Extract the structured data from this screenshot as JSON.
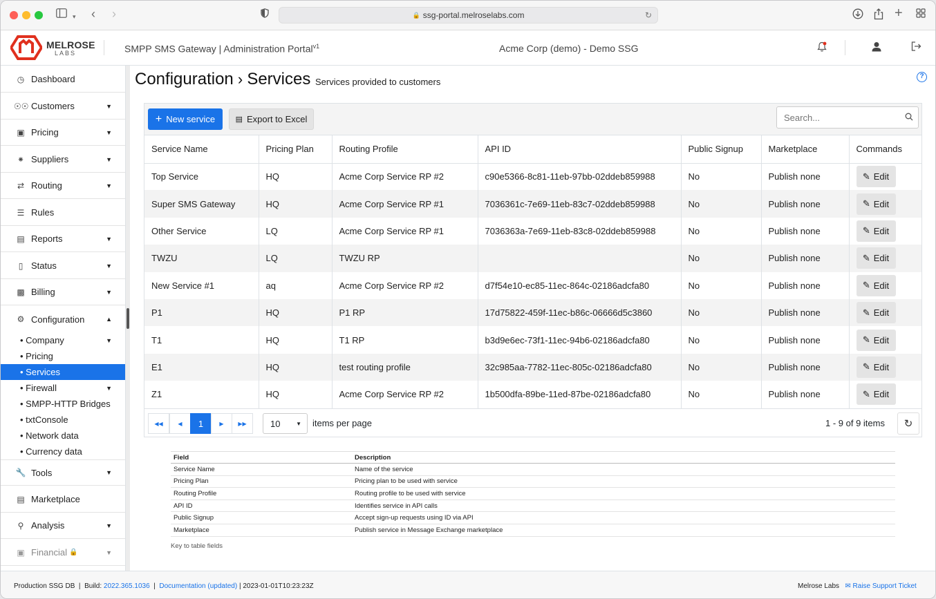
{
  "browser": {
    "url": "ssg-portal.melroselabs.com"
  },
  "logo": {
    "name": "MELROSE",
    "sub": "LABS"
  },
  "header": {
    "app_title": "SMPP SMS Gateway | Administration Portal",
    "app_version": "v1",
    "company": "Acme Corp (demo) - Demo SSG"
  },
  "sidebar": {
    "items": [
      {
        "label": "Dashboard"
      },
      {
        "label": "Customers"
      },
      {
        "label": "Pricing"
      },
      {
        "label": "Suppliers"
      },
      {
        "label": "Routing"
      },
      {
        "label": "Rules"
      },
      {
        "label": "Reports"
      },
      {
        "label": "Status"
      },
      {
        "label": "Billing"
      },
      {
        "label": "Configuration"
      }
    ],
    "config_sub": [
      {
        "label": "Company"
      },
      {
        "label": "Pricing"
      },
      {
        "label": "Services"
      },
      {
        "label": "Firewall"
      },
      {
        "label": "SMPP-HTTP Bridges"
      },
      {
        "label": "txtConsole"
      },
      {
        "label": "Network data"
      },
      {
        "label": "Currency data"
      }
    ],
    "bottom_items": [
      {
        "label": "Tools"
      },
      {
        "label": "Marketplace"
      },
      {
        "label": "Analysis"
      },
      {
        "label": "Financial"
      }
    ]
  },
  "page": {
    "title_parent": "Configuration",
    "title": "Services",
    "subtitle": "Services provided to customers"
  },
  "toolbar": {
    "new_label": "New service",
    "export_label": "Export to Excel",
    "search_placeholder": "Search..."
  },
  "table": {
    "columns": [
      "Service Name",
      "Pricing Plan",
      "Routing Profile",
      "API ID",
      "Public Signup",
      "Marketplace",
      "Commands"
    ],
    "edit_label": "Edit",
    "rows": [
      [
        "Top Service",
        "HQ",
        "Acme Corp Service RP #2",
        "c90e5366-8c81-11eb-97bb-02ddeb859988",
        "No",
        "Publish none"
      ],
      [
        "Super SMS Gateway",
        "HQ",
        "Acme Corp Service RP #1",
        "7036361c-7e69-11eb-83c7-02ddeb859988",
        "No",
        "Publish none"
      ],
      [
        "Other Service",
        "LQ",
        "Acme Corp Service RP #1",
        "7036363a-7e69-11eb-83c8-02ddeb859988",
        "No",
        "Publish none"
      ],
      [
        "TWZU",
        "LQ",
        "TWZU RP",
        "",
        "No",
        "Publish none"
      ],
      [
        "New Service #1",
        "aq",
        "Acme Corp Service RP #2",
        "d7f54e10-ec85-11ec-864c-02186adcfa80",
        "No",
        "Publish none"
      ],
      [
        "P1",
        "HQ",
        "P1 RP",
        "17d75822-459f-11ec-b86c-06666d5c3860",
        "No",
        "Publish none"
      ],
      [
        "T1",
        "HQ",
        "T1 RP",
        "b3d9e6ec-73f1-11ec-94b6-02186adcfa80",
        "No",
        "Publish none"
      ],
      [
        "E1",
        "HQ",
        "test routing profile",
        "32c985aa-7782-11ec-805c-02186adcfa80",
        "No",
        "Publish none"
      ],
      [
        "Z1",
        "HQ",
        "Acme Corp Service RP #2",
        "1b500dfa-89be-11ed-87be-02186adcfa80",
        "No",
        "Publish none"
      ]
    ]
  },
  "pager": {
    "current_page": "1",
    "page_size": "10",
    "items_per_page_label": "items per page",
    "count_label": "1 - 9 of 9 items"
  },
  "key": {
    "headers": [
      "Field",
      "Description"
    ],
    "rows": [
      [
        "Service Name",
        "Name of the service"
      ],
      [
        "Pricing Plan",
        "Pricing plan to be used with service"
      ],
      [
        "Routing Profile",
        "Routing profile to be used with service"
      ],
      [
        "API ID",
        "Identifies service in API calls"
      ],
      [
        "Public Signup",
        "Accept sign-up requests using ID via API"
      ],
      [
        "Marketplace",
        "Publish service in Message Exchange marketplace"
      ]
    ],
    "caption": "Key to table fields"
  },
  "footer": {
    "db": "Production SSG DB",
    "build_label": "Build:",
    "build": "2022.365.1036",
    "docs": "Documentation (updated)",
    "timestamp": "2023-01-01T10:23:23Z",
    "company": "Melrose Labs",
    "support": "Raise Support Ticket"
  },
  "colors": {
    "accent": "#1a73e8",
    "logo": "#e0301e"
  }
}
